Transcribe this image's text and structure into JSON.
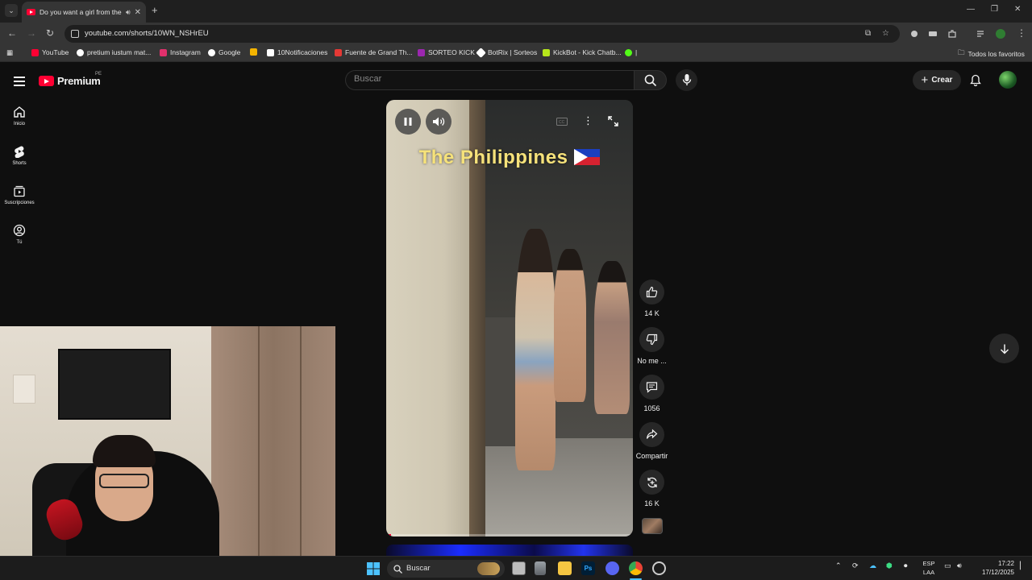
{
  "browser": {
    "tab_title": "Do you want a girl from the",
    "url": "youtube.com/shorts/10WN_NSHrEU",
    "bookmarks": [
      {
        "label": "YouTube",
        "color": "#ff0033"
      },
      {
        "label": "pretium iustum mat...",
        "color": "#8ab4f8"
      },
      {
        "label": "Instagram",
        "color": "#e1306c"
      },
      {
        "label": "Google",
        "color": "#4285f4"
      },
      {
        "label": "",
        "color": "#f4b400"
      },
      {
        "label": "10Notificaciones",
        "color": "#ffffff"
      },
      {
        "label": "Fuente de Grand Th...",
        "color": "#e53935"
      },
      {
        "label": "SORTEO KICK",
        "color": "#9c27b0"
      },
      {
        "label": "BotRix | Sorteos",
        "color": "#ffffff"
      },
      {
        "label": "KickBot - Kick Chatb...",
        "color": "#b6e61b"
      },
      {
        "label": "|",
        "color": "#53fc18"
      }
    ],
    "all_bookmarks_label": "Todos los favoritos"
  },
  "youtube": {
    "logo_text": "Premium",
    "country_code": "PE",
    "search_placeholder": "Buscar",
    "create_label": "Crear",
    "sidebar": [
      {
        "label": "Inicio",
        "icon": "home-icon"
      },
      {
        "label": "Shorts",
        "icon": "shorts-icon"
      },
      {
        "label": "Suscripciones",
        "icon": "subscriptions-icon"
      },
      {
        "label": "Tú",
        "icon": "you-icon"
      }
    ],
    "short": {
      "overlay_title": "The Philippines",
      "progress": 0.02
    },
    "actions": {
      "likes": "14 K",
      "dislike": "No me ...",
      "comments": "1056",
      "share": "Compartir",
      "remix": "16 K"
    }
  },
  "taskbar": {
    "search_label": "Buscar",
    "lang_line1": "ESP",
    "lang_line2": "LAA",
    "time": "17:22",
    "date": "17/12/2025"
  },
  "colors": {
    "yt_red": "#ff0033",
    "overlay_yellow": "#f6e27a"
  }
}
